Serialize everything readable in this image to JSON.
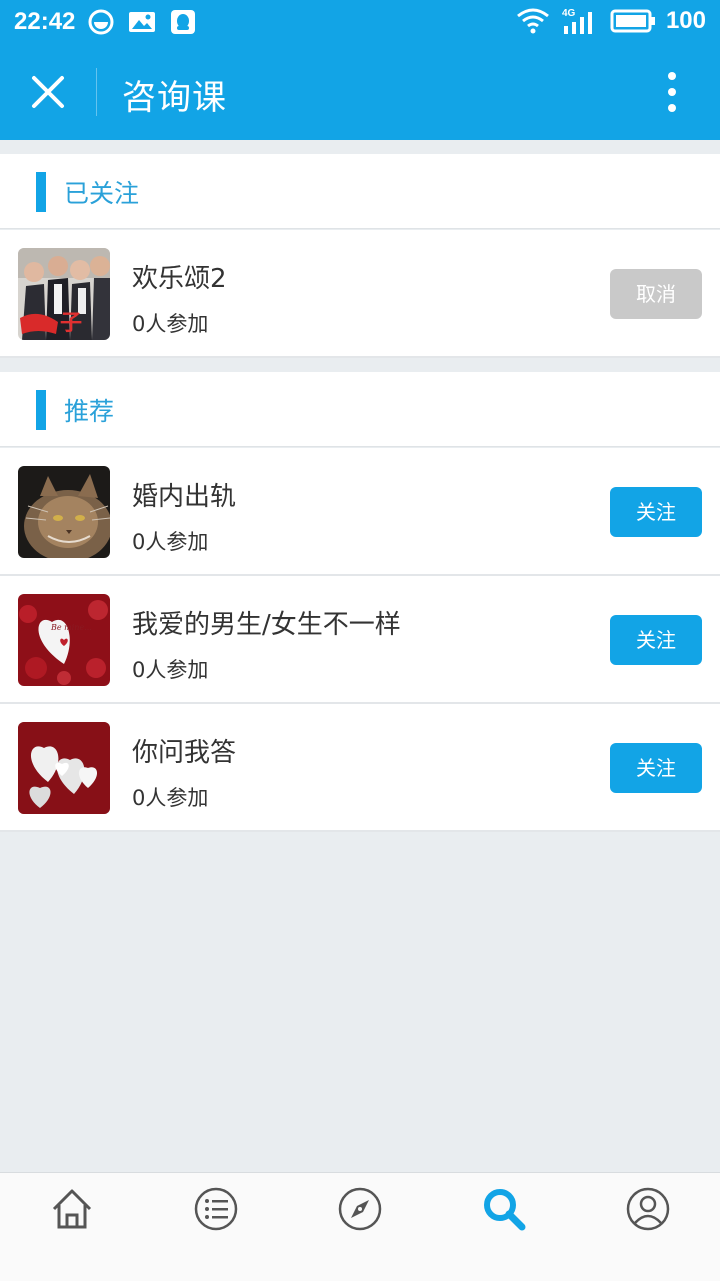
{
  "status_bar": {
    "time": "22:42",
    "network_label": "4G",
    "battery": "100"
  },
  "app_bar": {
    "title": "咨询课"
  },
  "followed_section": {
    "title": "已关注",
    "items": [
      {
        "title": "欢乐颂2",
        "participants": "0人参加",
        "action_label": "取消",
        "action_color": "#c9c9c9"
      }
    ]
  },
  "recommended_section": {
    "title": "推荐",
    "items": [
      {
        "title": "婚内出轨",
        "participants": "0人参加",
        "action_label": "关注",
        "action_color": "#12a4e6"
      },
      {
        "title": "我爱的男生/女生不一样",
        "participants": "0人参加",
        "action_label": "关注",
        "action_color": "#12a4e6"
      },
      {
        "title": "你问我答",
        "participants": "0人参加",
        "action_label": "关注",
        "action_color": "#12a4e6"
      }
    ]
  },
  "thumb_texts": {
    "heart_text": "Be mine..."
  },
  "bottom_nav": {
    "items": [
      {
        "icon": "home-icon"
      },
      {
        "icon": "list-icon"
      },
      {
        "icon": "compass-icon"
      },
      {
        "icon": "search-icon",
        "active": true
      },
      {
        "icon": "profile-icon"
      }
    ],
    "active_color": "#12a4e6",
    "inactive_color": "#555555"
  }
}
